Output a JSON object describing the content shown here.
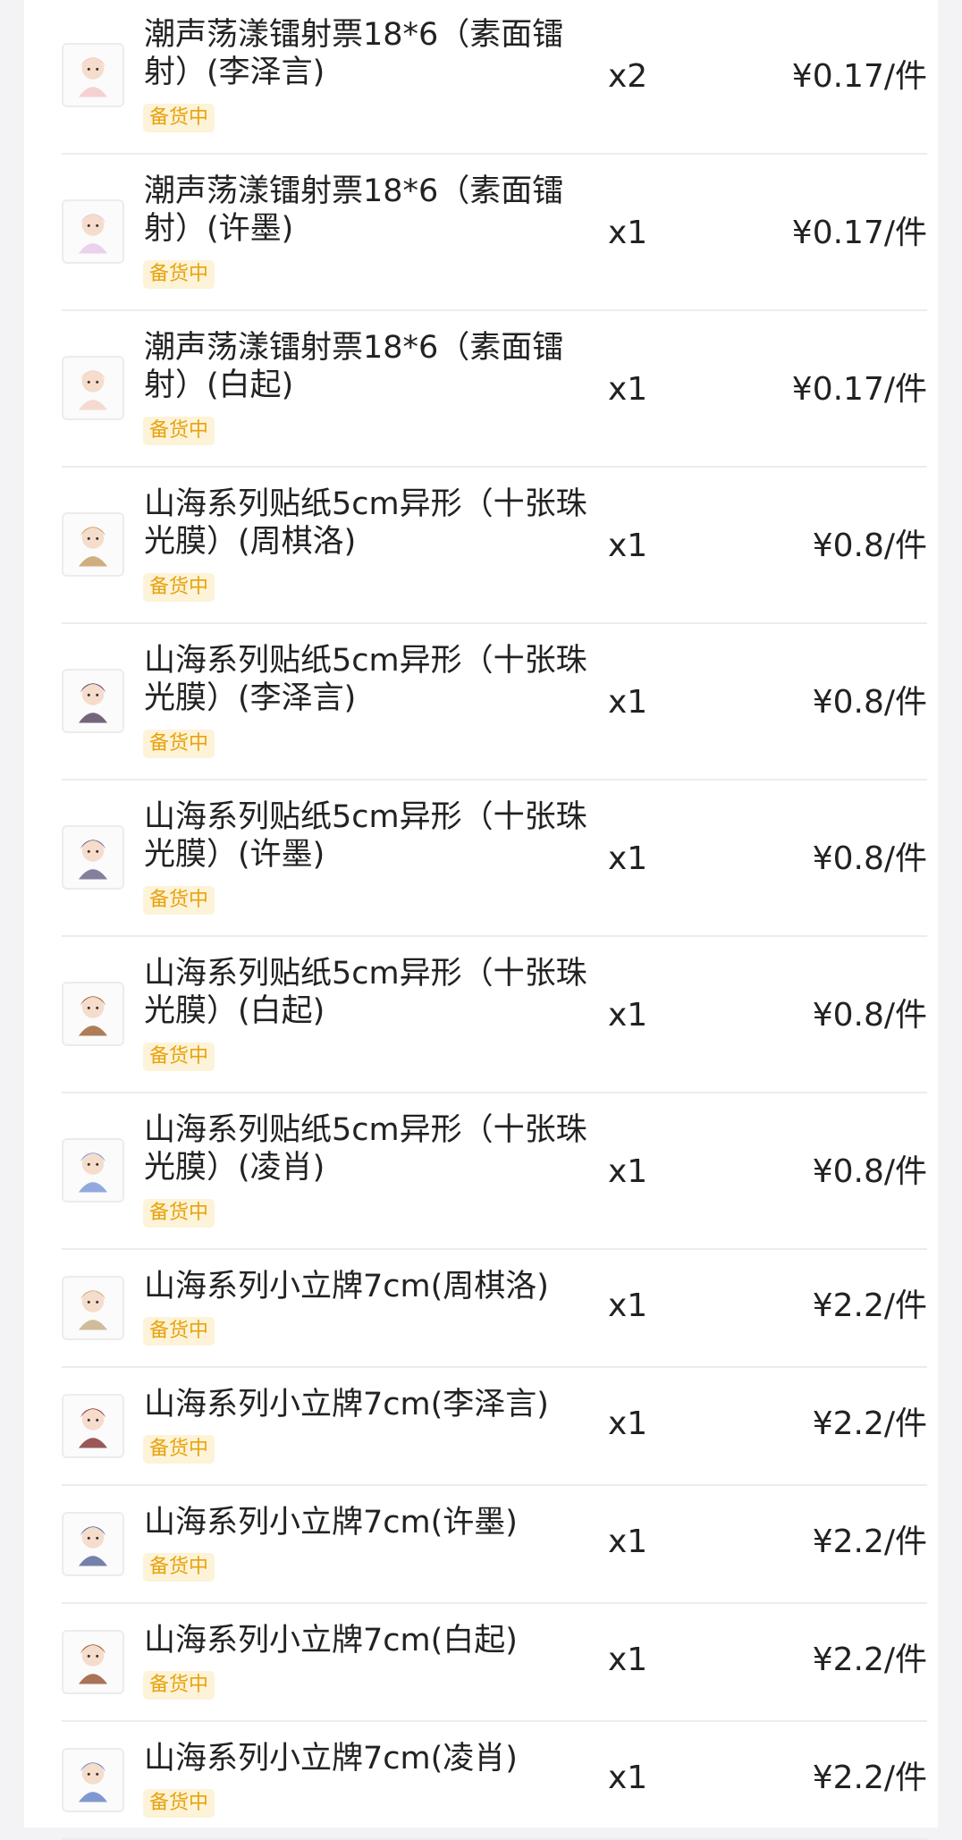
{
  "order_items": [
    {
      "title_line1": "潮声荡漾镭射票18*6（素面镭",
      "title_line2": "射）(李泽言)",
      "badge": "备货中",
      "qty": "x2",
      "price": "¥0.17/件",
      "thumb_icon": "character-thumbnail-icon",
      "thumb_color": "#f3c9c9"
    },
    {
      "title_line1": "潮声荡漾镭射票18*6（素面镭",
      "title_line2": "射）(许墨)",
      "badge": "备货中",
      "qty": "x1",
      "price": "¥0.17/件",
      "thumb_icon": "character-thumbnail-icon",
      "thumb_color": "#e7c9e8"
    },
    {
      "title_line1": "潮声荡漾镭射票18*6（素面镭",
      "title_line2": "射）(白起)",
      "badge": "备货中",
      "qty": "x1",
      "price": "¥0.17/件",
      "thumb_icon": "character-thumbnail-icon",
      "thumb_color": "#f4d3c7"
    },
    {
      "title_line1": "山海系列贴纸5cm异形（十张珠",
      "title_line2": "光膜）(周棋洛)",
      "badge": "备货中",
      "qty": "x1",
      "price": "¥0.8/件",
      "thumb_icon": "sticker-thumbnail-icon",
      "thumb_color": "#c9a06a"
    },
    {
      "title_line1": "山海系列贴纸5cm异形（十张珠",
      "title_line2": "光膜）(李泽言)",
      "badge": "备货中",
      "qty": "x1",
      "price": "¥0.8/件",
      "thumb_icon": "sticker-thumbnail-icon",
      "thumb_color": "#5a4a63"
    },
    {
      "title_line1": "山海系列贴纸5cm异形（十张珠",
      "title_line2": "光膜）(许墨)",
      "badge": "备货中",
      "qty": "x1",
      "price": "¥0.8/件",
      "thumb_icon": "sticker-thumbnail-icon",
      "thumb_color": "#6f6a8a"
    },
    {
      "title_line1": "山海系列贴纸5cm异形（十张珠",
      "title_line2": "光膜）(白起)",
      "badge": "备货中",
      "qty": "x1",
      "price": "¥0.8/件",
      "thumb_icon": "sticker-thumbnail-icon",
      "thumb_color": "#a0663b"
    },
    {
      "title_line1": "山海系列贴纸5cm异形（十张珠",
      "title_line2": "光膜）(凌肖)",
      "badge": "备货中",
      "qty": "x1",
      "price": "¥0.8/件",
      "thumb_icon": "sticker-thumbnail-icon",
      "thumb_color": "#7e9ad6"
    },
    {
      "title_line1": "山海系列小立牌7cm(周棋洛)",
      "title_line2": "",
      "badge": "备货中",
      "qty": "x1",
      "price": "¥2.2/件",
      "thumb_icon": "standee-thumbnail-icon",
      "thumb_color": "#c7b08a"
    },
    {
      "title_line1": "山海系列小立牌7cm(李泽言)",
      "title_line2": "",
      "badge": "备货中",
      "qty": "x1",
      "price": "¥2.2/件",
      "thumb_icon": "standee-thumbnail-icon",
      "thumb_color": "#8a3b3b"
    },
    {
      "title_line1": "山海系列小立牌7cm(许墨)",
      "title_line2": "",
      "badge": "备货中",
      "qty": "x1",
      "price": "¥2.2/件",
      "thumb_icon": "standee-thumbnail-icon",
      "thumb_color": "#5d6b9a"
    },
    {
      "title_line1": "山海系列小立牌7cm(白起)",
      "title_line2": "",
      "badge": "备货中",
      "qty": "x1",
      "price": "¥2.2/件",
      "thumb_icon": "standee-thumbnail-icon",
      "thumb_color": "#9a5a3a"
    },
    {
      "title_line1": "山海系列小立牌7cm(凌肖)",
      "title_line2": "",
      "badge": "备货中",
      "qty": "x1",
      "price": "¥2.2/件",
      "thumb_icon": "standee-thumbnail-icon",
      "thumb_color": "#6a86c9"
    }
  ],
  "colors": {
    "badge_text": "#e8a30f",
    "badge_bg": "#fdf3d8",
    "divider": "#ececec",
    "page_bg": "#f3f3f5"
  }
}
